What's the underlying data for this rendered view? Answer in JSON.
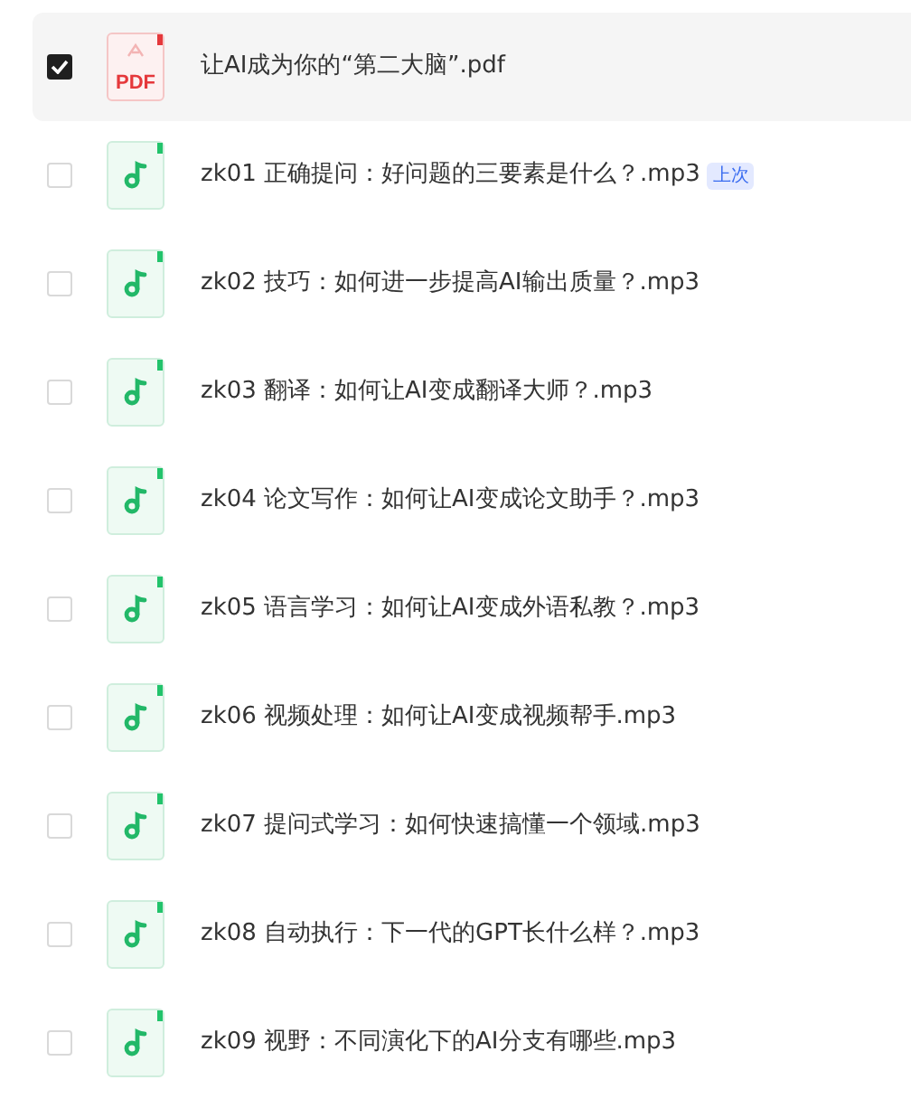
{
  "files": [
    {
      "kind": "pdf",
      "icon_label": "PDF",
      "name": "让AI成为你的“第二大脑”.pdf",
      "selected": true
    },
    {
      "kind": "audio",
      "name": "zk01 正确提问：好问题的三要素是什么？.mp3",
      "badge": "上次",
      "selected": false
    },
    {
      "kind": "audio",
      "name": "zk02 技巧：如何进一步提高AI输出质量？.mp3",
      "selected": false
    },
    {
      "kind": "audio",
      "name": "zk03 翻译：如何让AI变成翻译大师？.mp3",
      "selected": false
    },
    {
      "kind": "audio",
      "name": "zk04 论文写作：如何让AI变成论文助手？.mp3",
      "selected": false
    },
    {
      "kind": "audio",
      "name": "zk05 语言学习：如何让AI变成外语私教？.mp3",
      "selected": false
    },
    {
      "kind": "audio",
      "name": "zk06 视频处理：如何让AI变成视频帮手.mp3",
      "selected": false
    },
    {
      "kind": "audio",
      "name": "zk07 提问式学习：如何快速搞懂一个领域.mp3",
      "selected": false
    },
    {
      "kind": "audio",
      "name": "zk08 自动执行：下一代的GPT长什么样？.mp3",
      "selected": false
    },
    {
      "kind": "audio",
      "name": "zk09 视野：不同演化下的AI分支有哪些.mp3",
      "selected": false
    }
  ]
}
